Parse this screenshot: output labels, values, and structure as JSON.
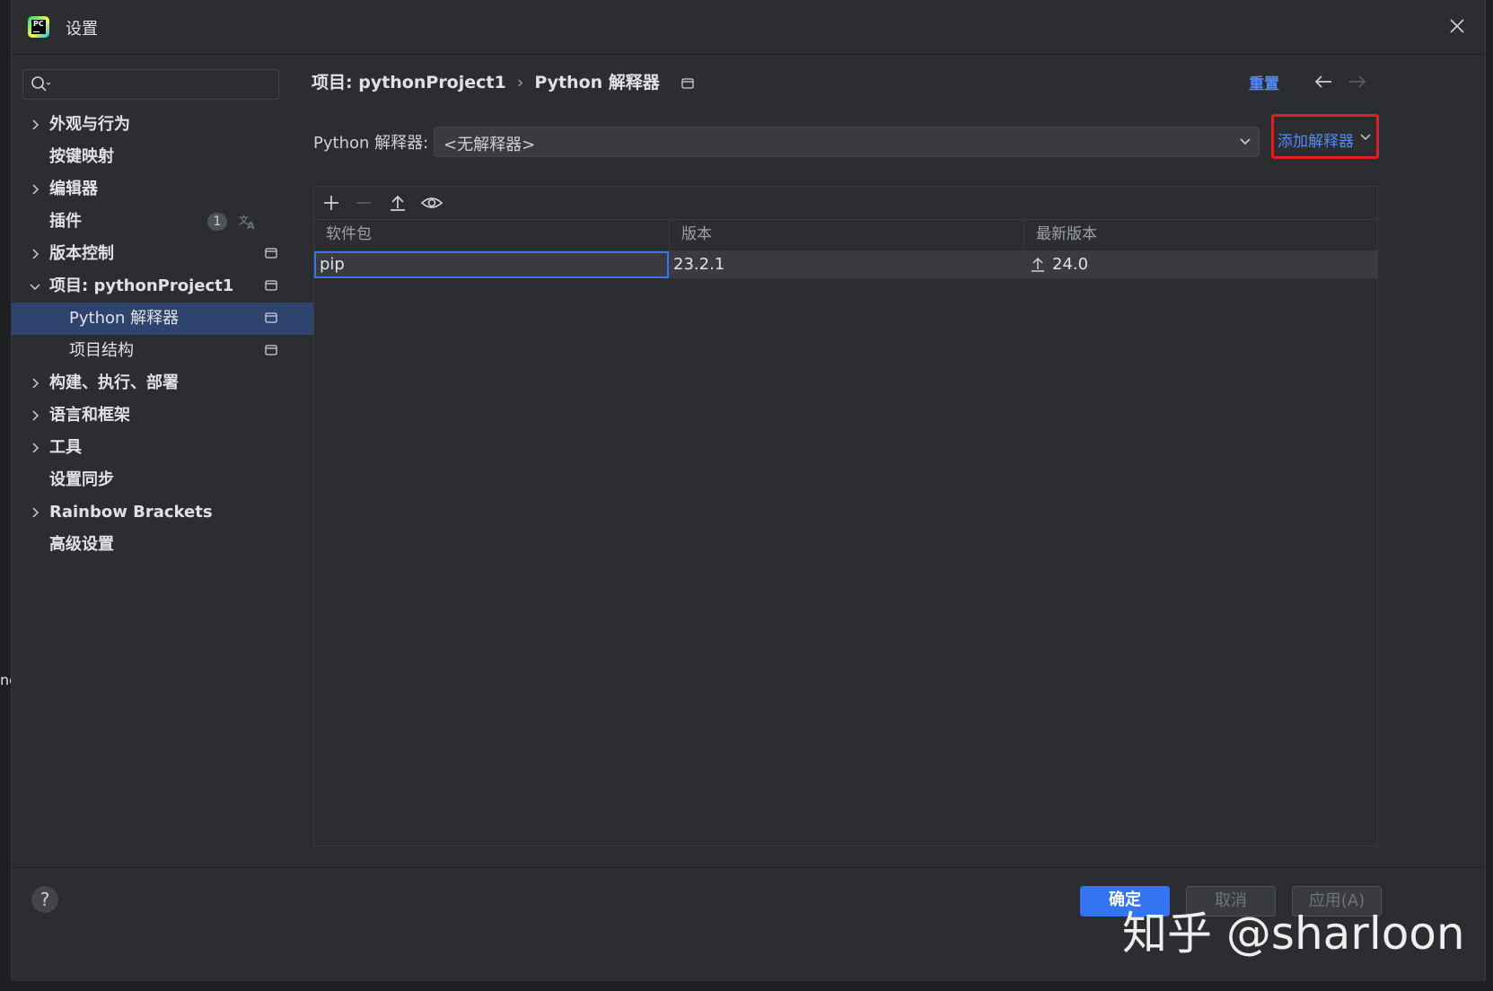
{
  "window": {
    "title": "设置",
    "edge_fragment": "nc"
  },
  "search": {
    "placeholder": "",
    "value": ""
  },
  "sidebar": {
    "items": [
      {
        "label": "外观与行为",
        "expandable": true
      },
      {
        "label": "按键映射",
        "expandable": false
      },
      {
        "label": "编辑器",
        "expandable": true
      },
      {
        "label": "插件",
        "expandable": false,
        "badge": "1"
      },
      {
        "label": "版本控制",
        "expandable": true
      },
      {
        "label": "项目: pythonProject1",
        "expandable": true,
        "expanded": true
      },
      {
        "label": "Python 解释器",
        "child": true,
        "selected": true
      },
      {
        "label": "项目结构",
        "child": true
      },
      {
        "label": "构建、执行、部署",
        "expandable": true
      },
      {
        "label": "语言和框架",
        "expandable": true
      },
      {
        "label": "工具",
        "expandable": true
      },
      {
        "label": "设置同步",
        "expandable": false
      },
      {
        "label": "Rainbow Brackets",
        "expandable": true
      },
      {
        "label": "高级设置",
        "expandable": false
      }
    ]
  },
  "header": {
    "breadcrumb": [
      "项目: pythonProject1",
      "Python 解释器"
    ],
    "separator": "›",
    "reset_label": "重置"
  },
  "interpreter": {
    "label": "Python 解释器:",
    "selected": "<无解释器>",
    "add_label": "添加解释器"
  },
  "packages": {
    "columns": [
      "软件包",
      "版本",
      "最新版本"
    ],
    "rows": [
      {
        "name": "pip",
        "version": "23.2.1",
        "latest": "24.0"
      }
    ]
  },
  "footer": {
    "help_label": "?",
    "ok_label": "确定",
    "cancel_label": "取消",
    "apply_label": "应用(A)"
  },
  "watermark": "知乎 @sharloon",
  "colors": {
    "accent": "#3574f0",
    "link": "#548af7",
    "highlight_box": "#e02020",
    "background": "#2b2d30",
    "selected_row": "#2e436e"
  }
}
